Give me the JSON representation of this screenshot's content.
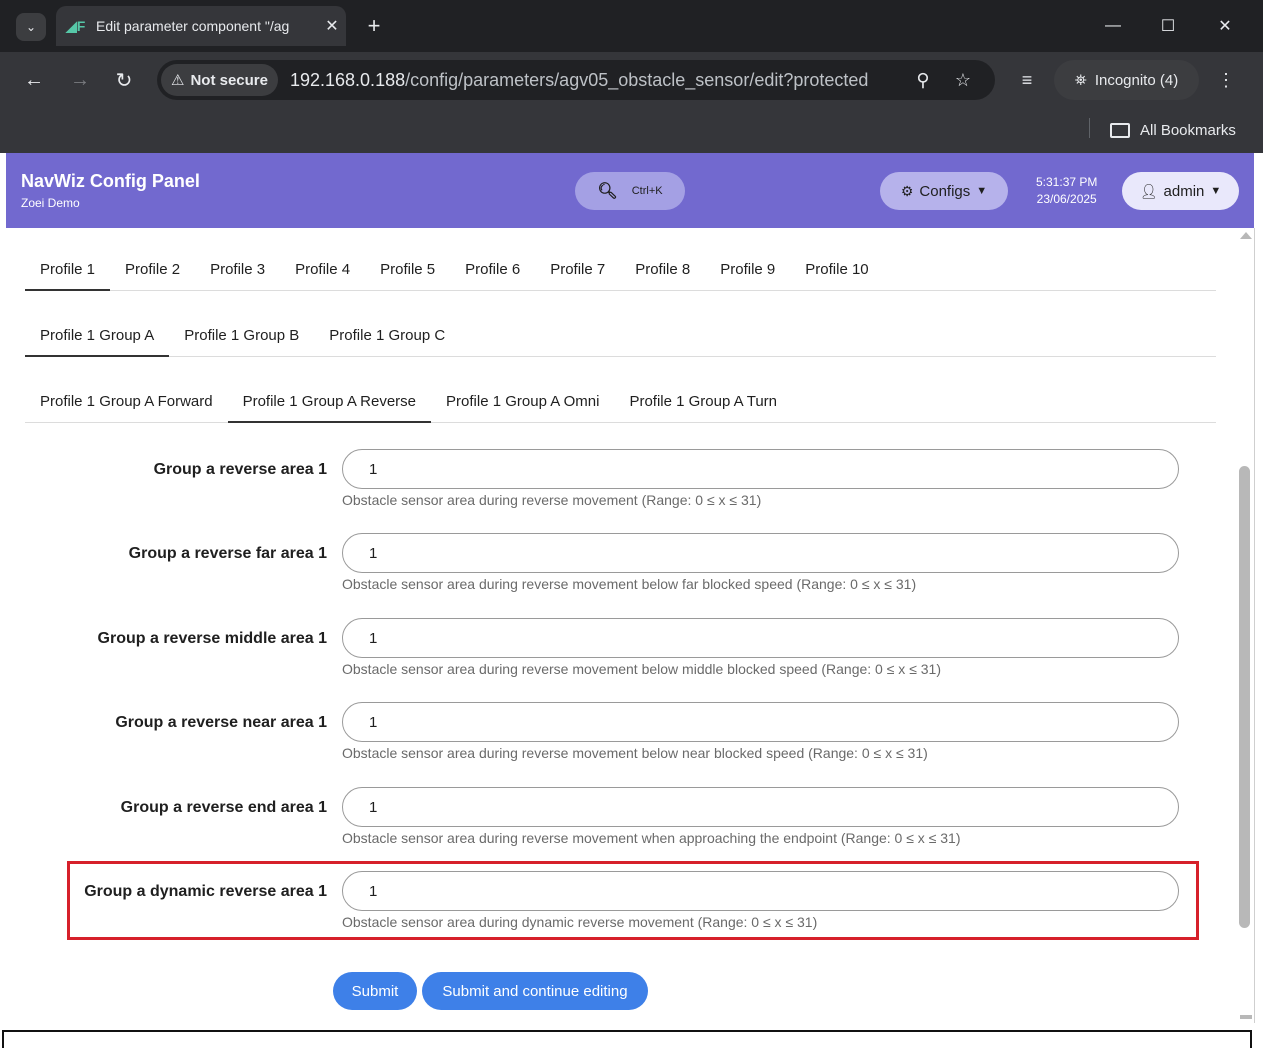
{
  "browser": {
    "tab_title": "Edit parameter component \"/ag",
    "tab_close": "✕",
    "new_tab": "+",
    "not_secure_label": "Not secure",
    "url_host": "192.168.0.188",
    "url_path": "/config/parameters/agv05_obstacle_sensor/edit?protected",
    "incognito_label": "Incognito (4)",
    "all_bookmarks": "All Bookmarks"
  },
  "app": {
    "title": "NavWiz Config Panel",
    "subtitle": "Zoei Demo",
    "search_shortcut": "Ctrl+K",
    "configs_label": "Configs",
    "time": "5:31:37 PM",
    "date": "23/06/2025",
    "user_label": "admin"
  },
  "profile_tabs": [
    "Profile 1",
    "Profile 2",
    "Profile 3",
    "Profile 4",
    "Profile 5",
    "Profile 6",
    "Profile 7",
    "Profile 8",
    "Profile 9",
    "Profile 10"
  ],
  "group_tabs": [
    "Profile 1 Group A",
    "Profile 1 Group B",
    "Profile 1 Group C"
  ],
  "direction_tabs": [
    "Profile 1 Group A Forward",
    "Profile 1 Group A Reverse",
    "Profile 1 Group A Omni",
    "Profile 1 Group A Turn"
  ],
  "active": {
    "profile": 0,
    "group": 0,
    "direction": 1
  },
  "fields": [
    {
      "label": "Group a reverse area 1",
      "value": "1",
      "help": "Obstacle sensor area during reverse movement (Range: 0 ≤ x ≤ 31)"
    },
    {
      "label": "Group a reverse far area 1",
      "value": "1",
      "help": "Obstacle sensor area during reverse movement below far blocked speed (Range: 0 ≤ x ≤ 31)"
    },
    {
      "label": "Group a reverse middle area 1",
      "value": "1",
      "help": "Obstacle sensor area during reverse movement below middle blocked speed (Range: 0 ≤ x ≤ 31)"
    },
    {
      "label": "Group a reverse near area 1",
      "value": "1",
      "help": "Obstacle sensor area during reverse movement below near blocked speed (Range: 0 ≤ x ≤ 31)"
    },
    {
      "label": "Group a reverse end area 1",
      "value": "1",
      "help": "Obstacle sensor area during reverse movement when approaching the endpoint (Range: 0 ≤ x ≤ 31)"
    },
    {
      "label": "Group a dynamic reverse area 1",
      "value": "1",
      "help": "Obstacle sensor area during dynamic reverse movement (Range: 0 ≤ x ≤ 31)"
    }
  ],
  "highlighted_field": 5,
  "buttons": {
    "submit": "Submit",
    "submit_continue": "Submit and continue editing"
  },
  "colors": {
    "navbar": "#7269cf",
    "button": "#3e80e8",
    "highlight": "#d6202a"
  }
}
